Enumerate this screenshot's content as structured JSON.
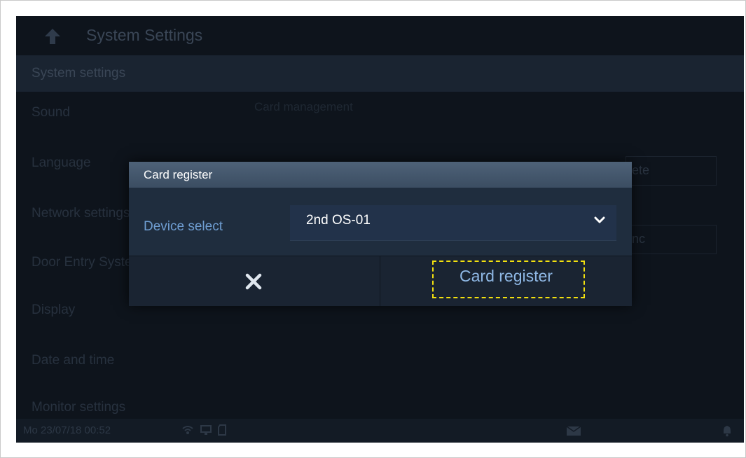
{
  "topbar": {
    "title": "System Settings",
    "back_icon": "back-arrow-icon"
  },
  "section": {
    "header": "System settings"
  },
  "menu": {
    "items": [
      "Sound",
      "Language",
      "Network settings",
      "Door Entry System",
      "Display",
      "Date and time",
      "Monitor settings"
    ]
  },
  "background_panel": {
    "title": "Card management",
    "button_delete": "ete",
    "button_sync": "nc"
  },
  "statusbar": {
    "time": "Mo 23/07/18  00:52"
  },
  "dialog": {
    "title": "Card register",
    "device_label": "Device select",
    "device_value": "2nd OS-01",
    "cancel_icon": "close-icon",
    "confirm_label": "Card register"
  },
  "colors": {
    "highlight": "#f3e10f",
    "accent_text": "#6f9ed2",
    "dialog_bg": "#1b2736"
  }
}
